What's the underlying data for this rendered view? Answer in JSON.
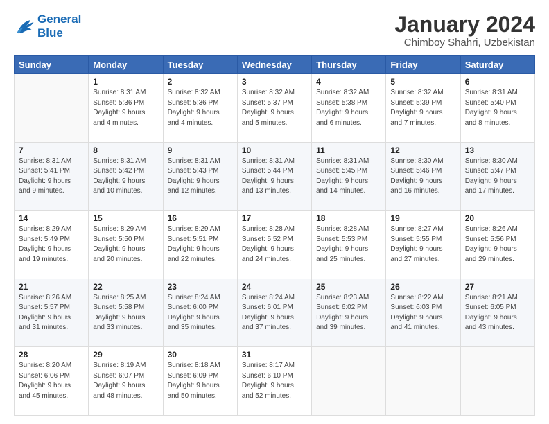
{
  "header": {
    "logo_line1": "General",
    "logo_line2": "Blue",
    "title": "January 2024",
    "subtitle": "Chimboy Shahri, Uzbekistan"
  },
  "days_of_week": [
    "Sunday",
    "Monday",
    "Tuesday",
    "Wednesday",
    "Thursday",
    "Friday",
    "Saturday"
  ],
  "weeks": [
    [
      {
        "day": "",
        "sunrise": "",
        "sunset": "",
        "daylight": ""
      },
      {
        "day": "1",
        "sunrise": "Sunrise: 8:31 AM",
        "sunset": "Sunset: 5:36 PM",
        "daylight": "Daylight: 9 hours and 4 minutes."
      },
      {
        "day": "2",
        "sunrise": "Sunrise: 8:32 AM",
        "sunset": "Sunset: 5:36 PM",
        "daylight": "Daylight: 9 hours and 4 minutes."
      },
      {
        "day": "3",
        "sunrise": "Sunrise: 8:32 AM",
        "sunset": "Sunset: 5:37 PM",
        "daylight": "Daylight: 9 hours and 5 minutes."
      },
      {
        "day": "4",
        "sunrise": "Sunrise: 8:32 AM",
        "sunset": "Sunset: 5:38 PM",
        "daylight": "Daylight: 9 hours and 6 minutes."
      },
      {
        "day": "5",
        "sunrise": "Sunrise: 8:32 AM",
        "sunset": "Sunset: 5:39 PM",
        "daylight": "Daylight: 9 hours and 7 minutes."
      },
      {
        "day": "6",
        "sunrise": "Sunrise: 8:31 AM",
        "sunset": "Sunset: 5:40 PM",
        "daylight": "Daylight: 9 hours and 8 minutes."
      }
    ],
    [
      {
        "day": "7",
        "sunrise": "Sunrise: 8:31 AM",
        "sunset": "Sunset: 5:41 PM",
        "daylight": "Daylight: 9 hours and 9 minutes."
      },
      {
        "day": "8",
        "sunrise": "Sunrise: 8:31 AM",
        "sunset": "Sunset: 5:42 PM",
        "daylight": "Daylight: 9 hours and 10 minutes."
      },
      {
        "day": "9",
        "sunrise": "Sunrise: 8:31 AM",
        "sunset": "Sunset: 5:43 PM",
        "daylight": "Daylight: 9 hours and 12 minutes."
      },
      {
        "day": "10",
        "sunrise": "Sunrise: 8:31 AM",
        "sunset": "Sunset: 5:44 PM",
        "daylight": "Daylight: 9 hours and 13 minutes."
      },
      {
        "day": "11",
        "sunrise": "Sunrise: 8:31 AM",
        "sunset": "Sunset: 5:45 PM",
        "daylight": "Daylight: 9 hours and 14 minutes."
      },
      {
        "day": "12",
        "sunrise": "Sunrise: 8:30 AM",
        "sunset": "Sunset: 5:46 PM",
        "daylight": "Daylight: 9 hours and 16 minutes."
      },
      {
        "day": "13",
        "sunrise": "Sunrise: 8:30 AM",
        "sunset": "Sunset: 5:47 PM",
        "daylight": "Daylight: 9 hours and 17 minutes."
      }
    ],
    [
      {
        "day": "14",
        "sunrise": "Sunrise: 8:29 AM",
        "sunset": "Sunset: 5:49 PM",
        "daylight": "Daylight: 9 hours and 19 minutes."
      },
      {
        "day": "15",
        "sunrise": "Sunrise: 8:29 AM",
        "sunset": "Sunset: 5:50 PM",
        "daylight": "Daylight: 9 hours and 20 minutes."
      },
      {
        "day": "16",
        "sunrise": "Sunrise: 8:29 AM",
        "sunset": "Sunset: 5:51 PM",
        "daylight": "Daylight: 9 hours and 22 minutes."
      },
      {
        "day": "17",
        "sunrise": "Sunrise: 8:28 AM",
        "sunset": "Sunset: 5:52 PM",
        "daylight": "Daylight: 9 hours and 24 minutes."
      },
      {
        "day": "18",
        "sunrise": "Sunrise: 8:28 AM",
        "sunset": "Sunset: 5:53 PM",
        "daylight": "Daylight: 9 hours and 25 minutes."
      },
      {
        "day": "19",
        "sunrise": "Sunrise: 8:27 AM",
        "sunset": "Sunset: 5:55 PM",
        "daylight": "Daylight: 9 hours and 27 minutes."
      },
      {
        "day": "20",
        "sunrise": "Sunrise: 8:26 AM",
        "sunset": "Sunset: 5:56 PM",
        "daylight": "Daylight: 9 hours and 29 minutes."
      }
    ],
    [
      {
        "day": "21",
        "sunrise": "Sunrise: 8:26 AM",
        "sunset": "Sunset: 5:57 PM",
        "daylight": "Daylight: 9 hours and 31 minutes."
      },
      {
        "day": "22",
        "sunrise": "Sunrise: 8:25 AM",
        "sunset": "Sunset: 5:58 PM",
        "daylight": "Daylight: 9 hours and 33 minutes."
      },
      {
        "day": "23",
        "sunrise": "Sunrise: 8:24 AM",
        "sunset": "Sunset: 6:00 PM",
        "daylight": "Daylight: 9 hours and 35 minutes."
      },
      {
        "day": "24",
        "sunrise": "Sunrise: 8:24 AM",
        "sunset": "Sunset: 6:01 PM",
        "daylight": "Daylight: 9 hours and 37 minutes."
      },
      {
        "day": "25",
        "sunrise": "Sunrise: 8:23 AM",
        "sunset": "Sunset: 6:02 PM",
        "daylight": "Daylight: 9 hours and 39 minutes."
      },
      {
        "day": "26",
        "sunrise": "Sunrise: 8:22 AM",
        "sunset": "Sunset: 6:03 PM",
        "daylight": "Daylight: 9 hours and 41 minutes."
      },
      {
        "day": "27",
        "sunrise": "Sunrise: 8:21 AM",
        "sunset": "Sunset: 6:05 PM",
        "daylight": "Daylight: 9 hours and 43 minutes."
      }
    ],
    [
      {
        "day": "28",
        "sunrise": "Sunrise: 8:20 AM",
        "sunset": "Sunset: 6:06 PM",
        "daylight": "Daylight: 9 hours and 45 minutes."
      },
      {
        "day": "29",
        "sunrise": "Sunrise: 8:19 AM",
        "sunset": "Sunset: 6:07 PM",
        "daylight": "Daylight: 9 hours and 48 minutes."
      },
      {
        "day": "30",
        "sunrise": "Sunrise: 8:18 AM",
        "sunset": "Sunset: 6:09 PM",
        "daylight": "Daylight: 9 hours and 50 minutes."
      },
      {
        "day": "31",
        "sunrise": "Sunrise: 8:17 AM",
        "sunset": "Sunset: 6:10 PM",
        "daylight": "Daylight: 9 hours and 52 minutes."
      },
      {
        "day": "",
        "sunrise": "",
        "sunset": "",
        "daylight": ""
      },
      {
        "day": "",
        "sunrise": "",
        "sunset": "",
        "daylight": ""
      },
      {
        "day": "",
        "sunrise": "",
        "sunset": "",
        "daylight": ""
      }
    ]
  ]
}
